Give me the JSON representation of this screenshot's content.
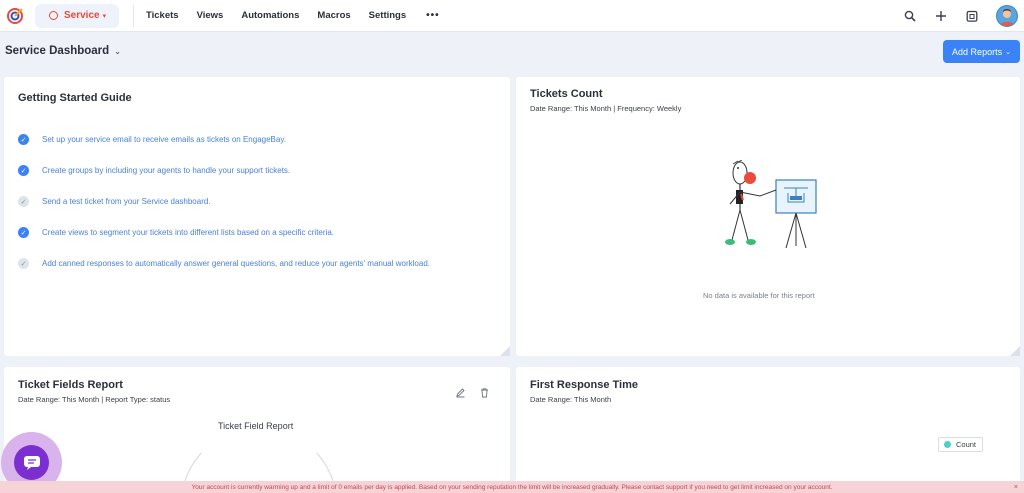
{
  "header": {
    "module_label": "Service",
    "nav": [
      "Tickets",
      "Views",
      "Automations",
      "Macros",
      "Settings"
    ],
    "more_label": "•••"
  },
  "dashboard": {
    "title": "Service Dashboard",
    "add_reports_label": "Add Reports"
  },
  "getting_started": {
    "title": "Getting Started Guide",
    "items": [
      {
        "text": "Set up your service email to receive emails as tickets on EngageBay.",
        "done": true
      },
      {
        "text": "Create groups by including your agents to handle your support tickets.",
        "done": true
      },
      {
        "text": "Send a test ticket from your Service dashboard.",
        "done": false
      },
      {
        "text": "Create views to segment your tickets into different lists based on a specific criteria.",
        "done": true
      },
      {
        "text": "Add canned responses to automatically answer general questions, and reduce your agents' manual workload.",
        "done": false
      }
    ]
  },
  "tickets_count": {
    "title": "Tickets Count",
    "subtitle": "Date Range: This Month | Frequency: Weekly",
    "empty_text": "No data is available for this report"
  },
  "ticket_fields": {
    "title": "Ticket Fields Report",
    "subtitle": "Date Range: This Month | Report Type: status",
    "chart_title": "Ticket Field Report"
  },
  "first_response": {
    "title": "First Response Time",
    "subtitle": "Date Range: This Month",
    "legend_label": "Count",
    "legend_color": "#4dd0c8"
  },
  "banner": {
    "text": "Your account is currently warming up and a limit of 0 emails per day is applied. Based on your sending reputation the limit will be increased gradually. Please contact support if you need to get limit increased on your account.",
    "close": "×"
  },
  "colors": {
    "accent": "#3b82f6",
    "service_red": "#e64a3b",
    "chat_purple": "#7b2fd0"
  }
}
